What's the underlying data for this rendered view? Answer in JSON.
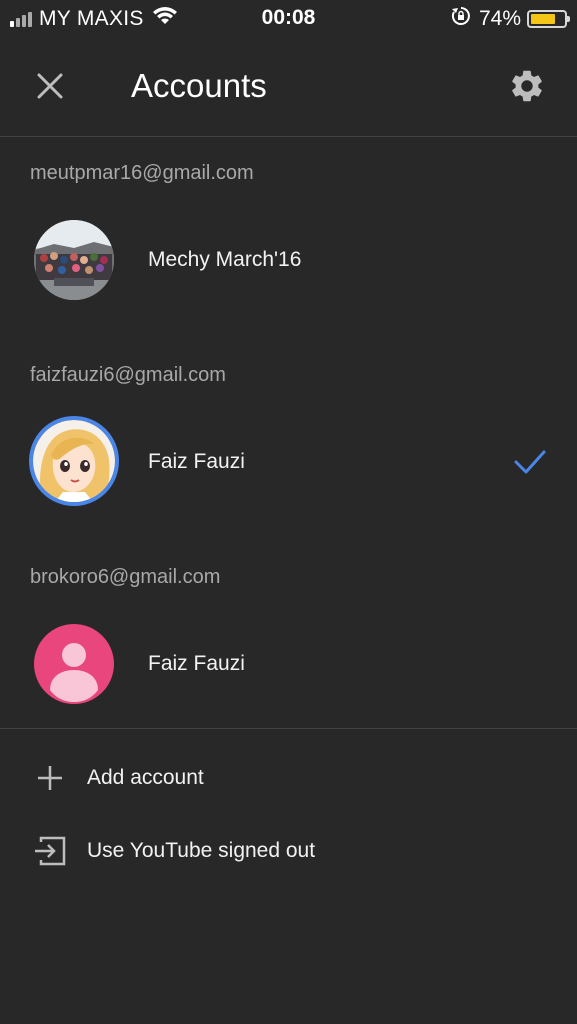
{
  "status_bar": {
    "carrier": "MY MAXIS",
    "time": "00:08",
    "battery_percent": "74%",
    "battery_level": 0.74,
    "battery_color": "#f5c518"
  },
  "header": {
    "title": "Accounts",
    "close_icon": "close-icon",
    "settings_icon": "gear-icon"
  },
  "accounts": [
    {
      "email": "meutpmar16@gmail.com",
      "name": "Mechy March'16",
      "selected": false
    },
    {
      "email": "faizfauzi6@gmail.com",
      "name": "Faiz Fauzi",
      "selected": true
    },
    {
      "email": "brokoro6@gmail.com",
      "name": "Faiz Fauzi",
      "selected": false
    }
  ],
  "actions": {
    "add_account": "Add account",
    "signed_out": "Use YouTube signed out"
  },
  "colors": {
    "background": "#282828",
    "accent_blue": "#4a86e8",
    "default_avatar": "#e8467c"
  }
}
